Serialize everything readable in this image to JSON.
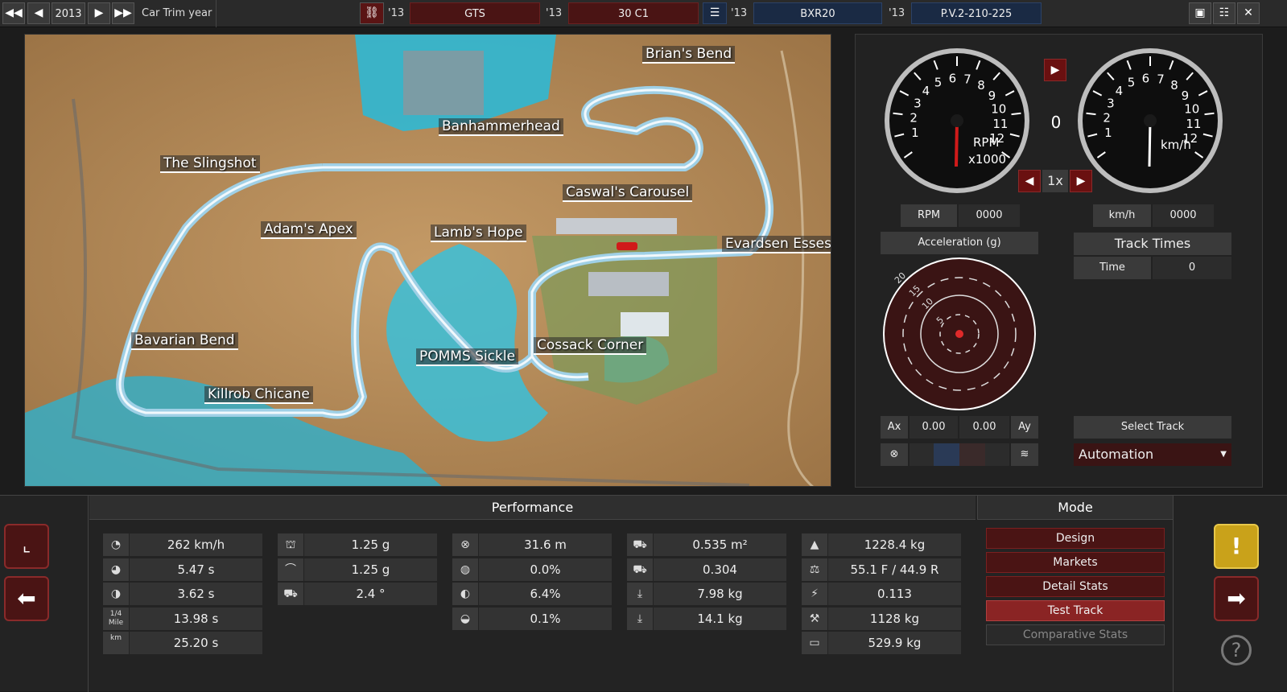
{
  "topbar": {
    "year": "2013",
    "trim_label": "Car Trim year",
    "car_year": "'13",
    "car_model": "GTS",
    "trim_year": "'13",
    "trim_name": "30 C1",
    "engine_year": "'13",
    "engine_family": "BXR20",
    "variant_year": "'13",
    "variant_name": "P.V.2-210-225"
  },
  "map": {
    "corners": [
      "Brian's Bend",
      "Banhammerhead",
      "The Slingshot",
      "Caswal's Carousel",
      "Adam's Apex",
      "Lamb's Hope",
      "Evardsen Esses",
      "Bavarian Bend",
      "POMMS Sickle",
      "Cossack Corner",
      "Killrob Chicane"
    ]
  },
  "gauges": {
    "rpm_unit": "RPM",
    "rpm_mult": "x1000",
    "speed_unit": "km/h",
    "gear": "0",
    "speed_mult": "1x",
    "rpm_label": "RPM",
    "rpm_value": "0000",
    "kmh_label": "km/h",
    "kmh_value": "0000",
    "rpm_ticks": [
      "1",
      "2",
      "3",
      "4",
      "5",
      "6",
      "7",
      "8",
      "9",
      "10",
      "11",
      "12"
    ],
    "speed_ticks": [
      "1",
      "2",
      "3",
      "4",
      "5",
      "6",
      "7",
      "8",
      "9",
      "10",
      "11",
      "12"
    ]
  },
  "accel": {
    "title": "Acceleration (g)",
    "ring_labels": [
      "20",
      "15",
      "10",
      "5"
    ],
    "ax_label": "Ax",
    "ax_value": "0.00",
    "ay_value": "0.00",
    "ay_label": "Ay"
  },
  "track_times": {
    "title": "Track Times",
    "time_label": "Time",
    "time_value": "0",
    "select_track": "Select Track",
    "track_option": "Automation"
  },
  "performance": {
    "title": "Performance",
    "col1": [
      {
        "icon": "top-speed-icon",
        "value": "262 km/h"
      },
      {
        "icon": "zero-to-100-icon",
        "value": "5.47 s"
      },
      {
        "icon": "eighty-to-120-icon",
        "value": "3.62 s"
      },
      {
        "icon": "quarter-mile-icon",
        "icon_text": "1/4 Mile",
        "value": "13.98 s"
      },
      {
        "icon": "one-km-icon",
        "icon_text": "km",
        "value": "25.20 s"
      }
    ],
    "col2": [
      {
        "icon": "lateral-grip-icon",
        "value": "1.25 g"
      },
      {
        "icon": "grip-icon",
        "value": "1.25 g"
      },
      {
        "icon": "body-roll-icon",
        "value": "2.4 °"
      }
    ],
    "col3": [
      {
        "icon": "braking-distance-icon",
        "value": "31.6 m"
      },
      {
        "icon": "brake-fade-icon",
        "value": "0.0%"
      },
      {
        "icon": "understeer-icon",
        "value": "6.4%"
      },
      {
        "icon": "oversteer-icon",
        "value": "0.1%"
      }
    ],
    "col4": [
      {
        "icon": "frontal-area-icon",
        "value": "0.535 m²"
      },
      {
        "icon": "drag-coefficient-icon",
        "value": "0.304"
      },
      {
        "icon": "front-downforce-icon",
        "value": "7.98 kg"
      },
      {
        "icon": "rear-downforce-icon",
        "value": "14.1 kg"
      }
    ],
    "col5": [
      {
        "icon": "weight-icon",
        "value": "1228.4 kg"
      },
      {
        "icon": "weight-distribution-icon",
        "value": "55.1 F / 44.9 R"
      },
      {
        "icon": "power-to-weight-icon",
        "value": "0.113"
      },
      {
        "icon": "towing-icon",
        "value": "1128 kg"
      },
      {
        "icon": "cargo-icon",
        "value": "529.9 kg"
      }
    ]
  },
  "mode": {
    "title": "Mode",
    "buttons": [
      "Design",
      "Markets",
      "Detail Stats",
      "Test Track",
      "Comparative Stats"
    ],
    "active": "Test Track",
    "disabled": "Comparative Stats"
  },
  "colors": {
    "accent_red": "#8a2424",
    "panel_blue": "#1a2a44",
    "warning_yellow": "#c9a21a"
  }
}
